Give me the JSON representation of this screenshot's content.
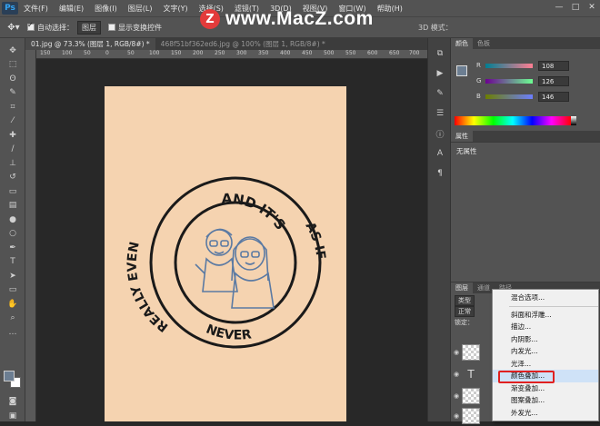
{
  "app": {
    "logo": "Ps"
  },
  "menubar": {
    "items": [
      "文件(F)",
      "编辑(E)",
      "图像(I)",
      "图层(L)",
      "文字(Y)",
      "选择(S)",
      "滤镜(T)",
      "3D(D)",
      "视图(V)",
      "窗口(W)",
      "帮助(H)"
    ],
    "window_controls": [
      "—",
      "□",
      "✕"
    ]
  },
  "watermark": {
    "badge": "Z",
    "text": "www.MacZ.com"
  },
  "options": {
    "tool_icon": "move-tool-icon",
    "auto_select_label": "自动选择：",
    "auto_select_checked": true,
    "auto_select_value": "图层",
    "show_transform_label": "显示变换控件",
    "show_transform_checked": false,
    "mode_3d_label": "3D 模式："
  },
  "tabs": [
    {
      "label": "01.jpg @ 73.3% (图层 1, RGB/8#) *",
      "active": true
    },
    {
      "label": "468f51bf362ed6.jpg @ 100% (图层 1, RGB/8#) *",
      "active": false
    }
  ],
  "ruler": {
    "h": [
      "150",
      "100",
      "50",
      "0",
      "50",
      "100",
      "150",
      "200",
      "250",
      "300",
      "350",
      "400",
      "450",
      "500",
      "550",
      "600",
      "650",
      "700"
    ]
  },
  "stamp": {
    "top_text": "AND IT'S",
    "left_text": "REALLY EVEN",
    "right_text": "AS IF",
    "bottom_text": "NEVER"
  },
  "colors": {
    "paper": "#f5d3b0",
    "foreground": "#6c7e92",
    "stamp_ink": "#1a1a1a",
    "sketch": "#5b7aa3",
    "highlight_box": "#e02020"
  },
  "color_panel": {
    "tabs": [
      "颜色",
      "色板"
    ],
    "channels": [
      {
        "label": "R",
        "value": "108"
      },
      {
        "label": "G",
        "value": "126"
      },
      {
        "label": "B",
        "value": "146"
      }
    ]
  },
  "properties_panel": {
    "tabs": [
      "属性"
    ],
    "empty_text": "无属性"
  },
  "layers_panel": {
    "tabs": [
      "图层",
      "通道",
      "路径"
    ],
    "kind_label": "类型",
    "blend_mode": "正常",
    "lock_label": "锁定："
  },
  "context_menu": {
    "items": [
      "混合选项...",
      "斜面和浮雕...",
      "描边...",
      "内阴影...",
      "内发光...",
      "光泽...",
      "颜色叠加...",
      "渐变叠加...",
      "图案叠加...",
      "外发光..."
    ],
    "highlighted": "颜色叠加..."
  }
}
